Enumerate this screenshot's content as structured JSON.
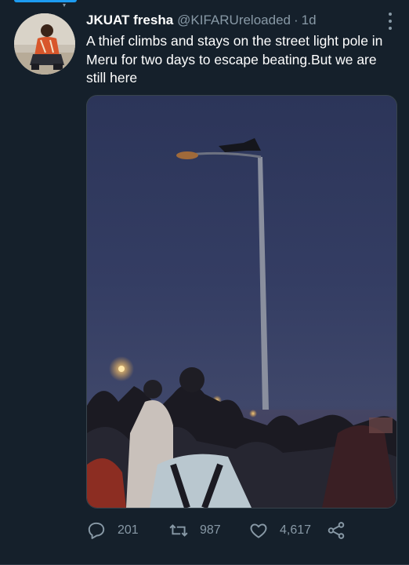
{
  "tweet": {
    "display_name": "JKUAT fresha",
    "handle": "@KIFARUreloaded",
    "separator": "·",
    "time": "1d",
    "text": "A thief climbs and stays on the  street light pole in Meru for two days  to escape beating.But we are still here"
  },
  "actions": {
    "reply_count": "201",
    "retweet_count": "987",
    "like_count": "4,617"
  },
  "icons": {
    "more": "more-vertical-icon",
    "reply": "reply-icon",
    "retweet": "retweet-icon",
    "like": "heart-icon",
    "share": "share-icon"
  },
  "colors": {
    "background": "#15202b",
    "muted_text": "#8899a6",
    "accent": "#1d9bf0"
  }
}
